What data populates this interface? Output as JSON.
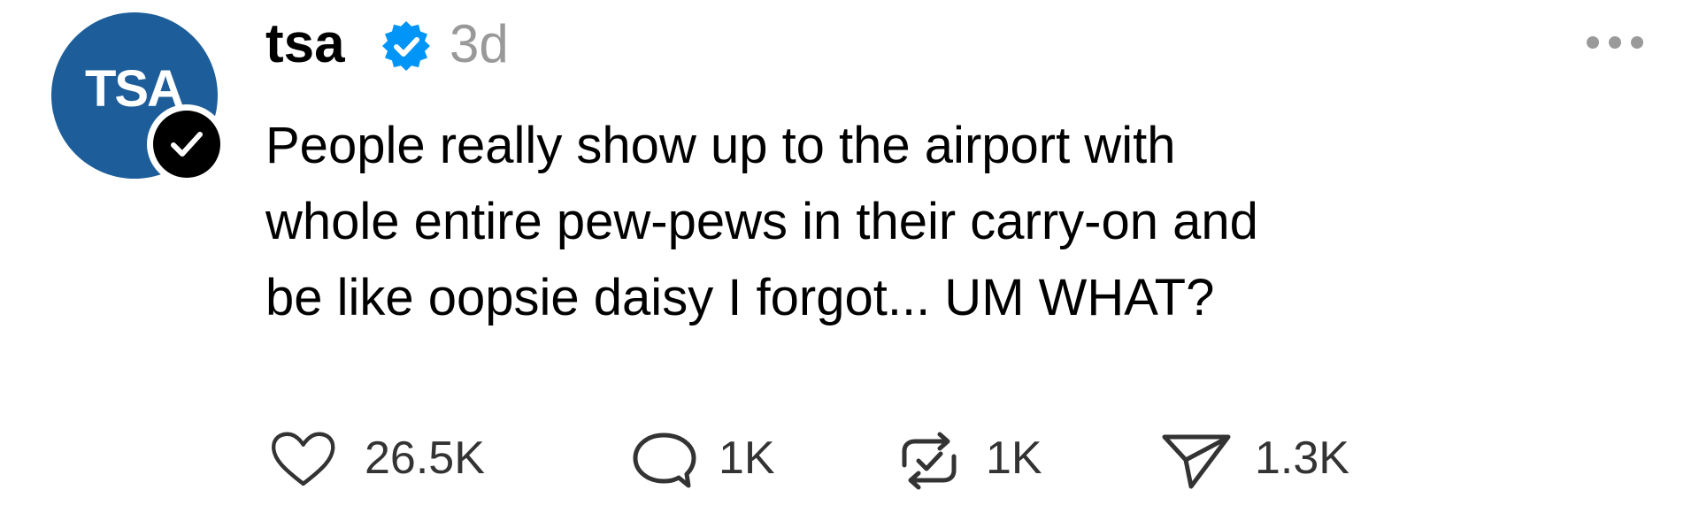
{
  "post": {
    "avatar_text": "TSA",
    "username": "tsa",
    "timestamp": "3d",
    "lines": [
      "People really show up to the airport with",
      "whole entire pew-pews in their carry-on and",
      "be like oopsie daisy I forgot... UM WHAT?"
    ],
    "actions": {
      "likes": "26.5K",
      "replies": "1K",
      "reposts": "1K",
      "shares": "1.3K"
    }
  },
  "icons": {
    "verified": "verified-badge-icon",
    "avatar_check": "checkmark-icon",
    "more": "more-options-icon",
    "like": "heart-icon",
    "reply": "speech-bubble-icon",
    "repost": "repost-icon",
    "share": "paper-plane-icon"
  },
  "colors": {
    "avatar_bg": "#1d5e9a",
    "verified_blue": "#0095f6",
    "muted_text": "#999999",
    "action_text": "#333333"
  }
}
